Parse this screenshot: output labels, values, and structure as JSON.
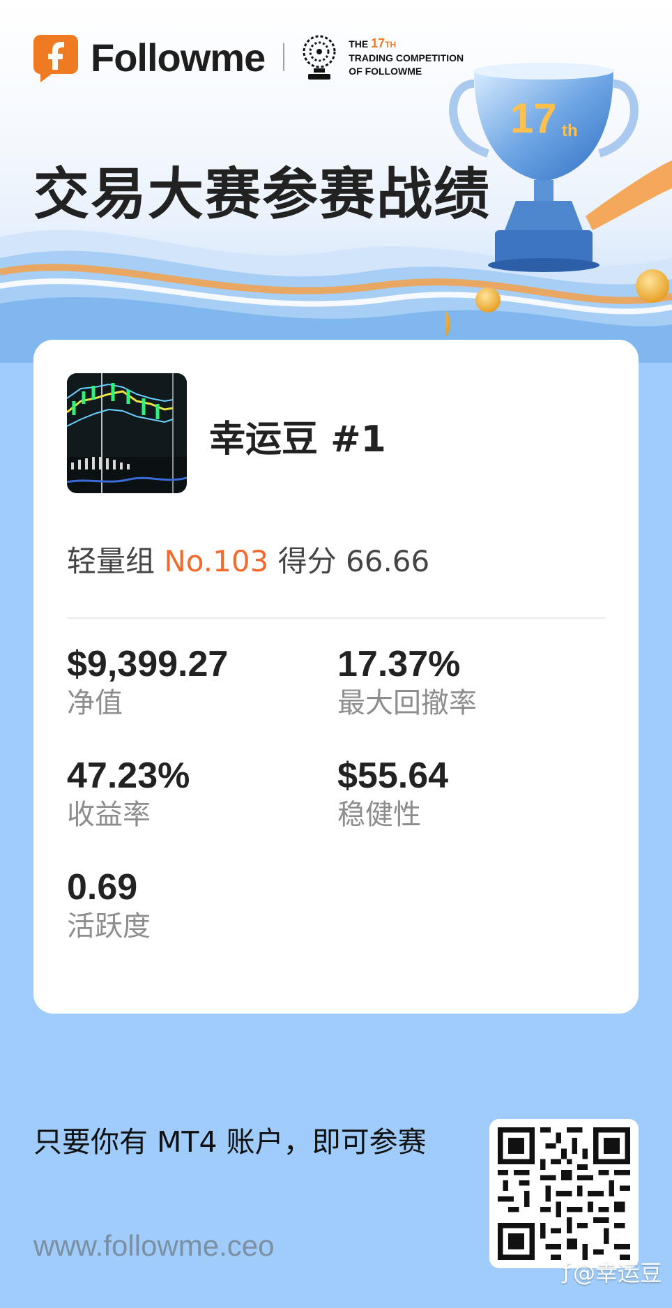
{
  "brand": {
    "name": "Followme",
    "competition_line1": "THE",
    "competition_number": "17",
    "competition_suffix": "TH",
    "competition_line2": "TRADING COMPETITION",
    "competition_line3": "OF FOLLOWME"
  },
  "hero": {
    "title": "交易大赛参赛战绩",
    "trophy_number": "17",
    "trophy_suffix": "th"
  },
  "player": {
    "name": "幸运豆 #1",
    "group_label": "轻量组",
    "rank": "No.103",
    "score_label": "得分",
    "score_value": "66.66"
  },
  "stats": [
    {
      "value": "$9,399.27",
      "label": "净值"
    },
    {
      "value": "17.37%",
      "label": "最大回撤率"
    },
    {
      "value": "47.23%",
      "label": "收益率"
    },
    {
      "value": "$55.64",
      "label": "稳健性"
    },
    {
      "value": "0.69",
      "label": "活跃度"
    }
  ],
  "footer": {
    "slogan": "只要你有 MT4 账户，即可参赛",
    "url": "www.followme.ceo"
  },
  "watermark": {
    "text": "@幸运豆"
  },
  "colors": {
    "accent_orange": "#f26a2c",
    "page_blue": "#9fccfa",
    "card_white": "#ffffff"
  }
}
